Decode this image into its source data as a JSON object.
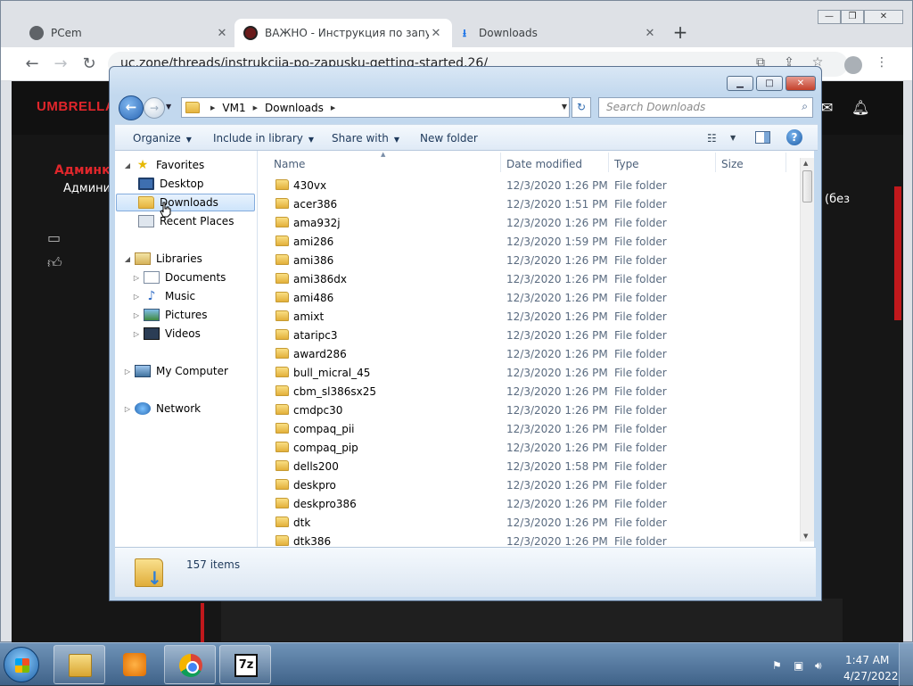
{
  "chrome": {
    "tabs": [
      {
        "title": "PCem",
        "close": "✕"
      },
      {
        "title": "ВАЖНО - Инструкция по запуску",
        "close": "✕"
      },
      {
        "title": "Downloads",
        "close": "✕"
      }
    ],
    "new_tab": "+",
    "window_controls": {
      "minimize": "—",
      "maximize": "❐",
      "close": "✕"
    },
    "url": "uc.zone/threads/instrukcija-po-zapusku-getting-started.26/",
    "site": {
      "logo": "UMBRELLA",
      "user_name_red": "Админко",
      "user_role": "Админис",
      "side_text": "(без"
    }
  },
  "explorer": {
    "breadcrumb": [
      "VM1",
      "Downloads"
    ],
    "search_placeholder": "Search Downloads",
    "commands": {
      "organize": "Organize",
      "include_in_library": "Include in library",
      "share_with": "Share with",
      "new_folder": "New folder"
    },
    "nav": {
      "favorites": "Favorites",
      "desktop": "Desktop",
      "downloads": "Downloads",
      "recent_places": "Recent Places",
      "libraries": "Libraries",
      "documents": "Documents",
      "music": "Music",
      "pictures": "Pictures",
      "videos": "Videos",
      "my_computer": "My Computer",
      "network": "Network"
    },
    "columns": {
      "name": "Name",
      "date": "Date modified",
      "type": "Type",
      "size": "Size"
    },
    "files": [
      {
        "name": "430vx",
        "date": "12/3/2020 1:26 PM",
        "type": "File folder"
      },
      {
        "name": "acer386",
        "date": "12/3/2020 1:51 PM",
        "type": "File folder"
      },
      {
        "name": "ama932j",
        "date": "12/3/2020 1:26 PM",
        "type": "File folder"
      },
      {
        "name": "ami286",
        "date": "12/3/2020 1:59 PM",
        "type": "File folder"
      },
      {
        "name": "ami386",
        "date": "12/3/2020 1:26 PM",
        "type": "File folder"
      },
      {
        "name": "ami386dx",
        "date": "12/3/2020 1:26 PM",
        "type": "File folder"
      },
      {
        "name": "ami486",
        "date": "12/3/2020 1:26 PM",
        "type": "File folder"
      },
      {
        "name": "amixt",
        "date": "12/3/2020 1:26 PM",
        "type": "File folder"
      },
      {
        "name": "ataripc3",
        "date": "12/3/2020 1:26 PM",
        "type": "File folder"
      },
      {
        "name": "award286",
        "date": "12/3/2020 1:26 PM",
        "type": "File folder"
      },
      {
        "name": "bull_micral_45",
        "date": "12/3/2020 1:26 PM",
        "type": "File folder"
      },
      {
        "name": "cbm_sl386sx25",
        "date": "12/3/2020 1:26 PM",
        "type": "File folder"
      },
      {
        "name": "cmdpc30",
        "date": "12/3/2020 1:26 PM",
        "type": "File folder"
      },
      {
        "name": "compaq_pii",
        "date": "12/3/2020 1:26 PM",
        "type": "File folder"
      },
      {
        "name": "compaq_pip",
        "date": "12/3/2020 1:26 PM",
        "type": "File folder"
      },
      {
        "name": "dells200",
        "date": "12/3/2020 1:58 PM",
        "type": "File folder"
      },
      {
        "name": "deskpro",
        "date": "12/3/2020 1:26 PM",
        "type": "File folder"
      },
      {
        "name": "deskpro386",
        "date": "12/3/2020 1:26 PM",
        "type": "File folder"
      },
      {
        "name": "dtk",
        "date": "12/3/2020 1:26 PM",
        "type": "File folder"
      },
      {
        "name": "dtk386",
        "date": "12/3/2020 1:26 PM",
        "type": "File folder"
      }
    ],
    "status": "157 items"
  },
  "taskbar": {
    "seven_zip_label": "7z",
    "time": "1:47 AM",
    "date": "4/27/2022"
  }
}
